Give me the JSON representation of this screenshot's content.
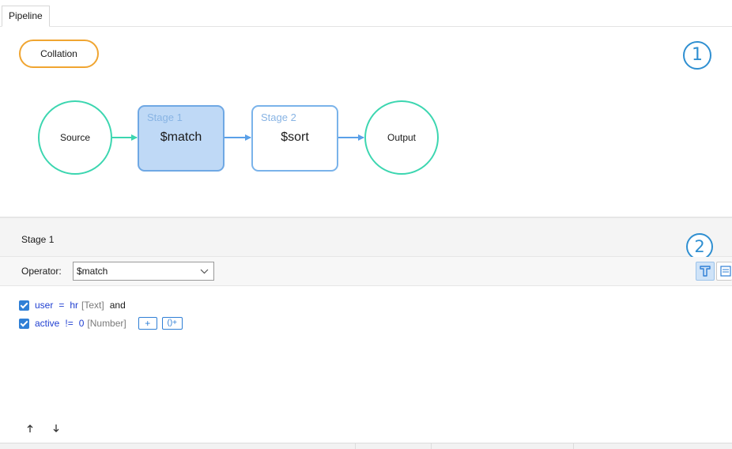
{
  "tabs": [
    {
      "label": "Pipeline"
    }
  ],
  "canvas": {
    "collation_label": "Collation",
    "badge_1": "1",
    "source_label": "Source",
    "output_label": "Output",
    "stages": [
      {
        "label": "Stage 1",
        "operator": "$match",
        "selected": true
      },
      {
        "label": "Stage 2",
        "operator": "$sort",
        "selected": false
      }
    ]
  },
  "stage_panel": {
    "title": "Stage 1",
    "badge_2": "2",
    "operator_label": "Operator:",
    "operator_value": "$match",
    "conditions": [
      {
        "checked": true,
        "field": "user",
        "operator": "=",
        "value": "hr",
        "type": "[Text]",
        "conjunction": "and"
      },
      {
        "checked": true,
        "field": "active",
        "operator": "!=",
        "value": "0",
        "type": "[Number]"
      }
    ],
    "add_condition_label": "+",
    "add_group_label": "()+"
  },
  "icons": {
    "filter_tool": "filter-icon",
    "list_tool": "list-icon",
    "move_up": "arrow-up-icon",
    "move_down": "arrow-down-icon"
  },
  "colors": {
    "accent_blue": "#2f7fd6",
    "collation_border": "#f0a531",
    "node_green": "#3cd6b0",
    "stage_selected_fill": "#bfd9f6",
    "badge_blue": "#2f8fd1"
  }
}
